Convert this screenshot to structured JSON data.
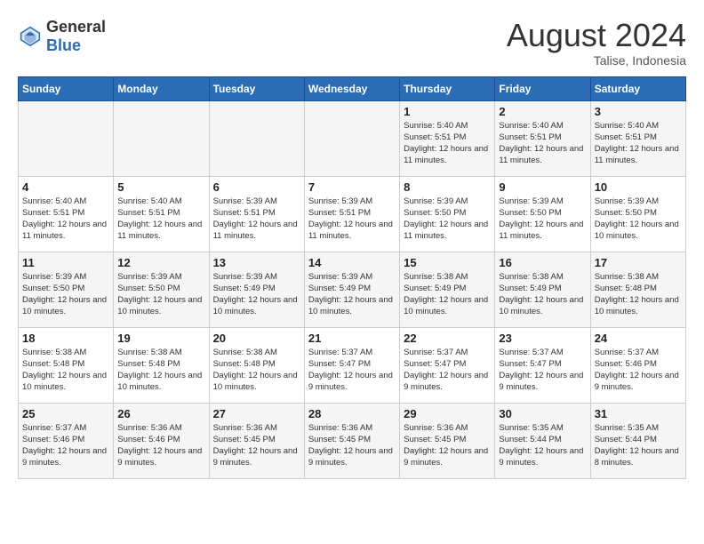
{
  "logo": {
    "text_general": "General",
    "text_blue": "Blue"
  },
  "title": "August 2024",
  "subtitle": "Talise, Indonesia",
  "weekdays": [
    "Sunday",
    "Monday",
    "Tuesday",
    "Wednesday",
    "Thursday",
    "Friday",
    "Saturday"
  ],
  "weeks": [
    [
      {
        "day": "",
        "sunrise": "",
        "sunset": "",
        "daylight": ""
      },
      {
        "day": "",
        "sunrise": "",
        "sunset": "",
        "daylight": ""
      },
      {
        "day": "",
        "sunrise": "",
        "sunset": "",
        "daylight": ""
      },
      {
        "day": "",
        "sunrise": "",
        "sunset": "",
        "daylight": ""
      },
      {
        "day": "1",
        "sunrise": "Sunrise: 5:40 AM",
        "sunset": "Sunset: 5:51 PM",
        "daylight": "Daylight: 12 hours and 11 minutes."
      },
      {
        "day": "2",
        "sunrise": "Sunrise: 5:40 AM",
        "sunset": "Sunset: 5:51 PM",
        "daylight": "Daylight: 12 hours and 11 minutes."
      },
      {
        "day": "3",
        "sunrise": "Sunrise: 5:40 AM",
        "sunset": "Sunset: 5:51 PM",
        "daylight": "Daylight: 12 hours and 11 minutes."
      }
    ],
    [
      {
        "day": "4",
        "sunrise": "Sunrise: 5:40 AM",
        "sunset": "Sunset: 5:51 PM",
        "daylight": "Daylight: 12 hours and 11 minutes."
      },
      {
        "day": "5",
        "sunrise": "Sunrise: 5:40 AM",
        "sunset": "Sunset: 5:51 PM",
        "daylight": "Daylight: 12 hours and 11 minutes."
      },
      {
        "day": "6",
        "sunrise": "Sunrise: 5:39 AM",
        "sunset": "Sunset: 5:51 PM",
        "daylight": "Daylight: 12 hours and 11 minutes."
      },
      {
        "day": "7",
        "sunrise": "Sunrise: 5:39 AM",
        "sunset": "Sunset: 5:51 PM",
        "daylight": "Daylight: 12 hours and 11 minutes."
      },
      {
        "day": "8",
        "sunrise": "Sunrise: 5:39 AM",
        "sunset": "Sunset: 5:50 PM",
        "daylight": "Daylight: 12 hours and 11 minutes."
      },
      {
        "day": "9",
        "sunrise": "Sunrise: 5:39 AM",
        "sunset": "Sunset: 5:50 PM",
        "daylight": "Daylight: 12 hours and 11 minutes."
      },
      {
        "day": "10",
        "sunrise": "Sunrise: 5:39 AM",
        "sunset": "Sunset: 5:50 PM",
        "daylight": "Daylight: 12 hours and 10 minutes."
      }
    ],
    [
      {
        "day": "11",
        "sunrise": "Sunrise: 5:39 AM",
        "sunset": "Sunset: 5:50 PM",
        "daylight": "Daylight: 12 hours and 10 minutes."
      },
      {
        "day": "12",
        "sunrise": "Sunrise: 5:39 AM",
        "sunset": "Sunset: 5:50 PM",
        "daylight": "Daylight: 12 hours and 10 minutes."
      },
      {
        "day": "13",
        "sunrise": "Sunrise: 5:39 AM",
        "sunset": "Sunset: 5:49 PM",
        "daylight": "Daylight: 12 hours and 10 minutes."
      },
      {
        "day": "14",
        "sunrise": "Sunrise: 5:39 AM",
        "sunset": "Sunset: 5:49 PM",
        "daylight": "Daylight: 12 hours and 10 minutes."
      },
      {
        "day": "15",
        "sunrise": "Sunrise: 5:38 AM",
        "sunset": "Sunset: 5:49 PM",
        "daylight": "Daylight: 12 hours and 10 minutes."
      },
      {
        "day": "16",
        "sunrise": "Sunrise: 5:38 AM",
        "sunset": "Sunset: 5:49 PM",
        "daylight": "Daylight: 12 hours and 10 minutes."
      },
      {
        "day": "17",
        "sunrise": "Sunrise: 5:38 AM",
        "sunset": "Sunset: 5:48 PM",
        "daylight": "Daylight: 12 hours and 10 minutes."
      }
    ],
    [
      {
        "day": "18",
        "sunrise": "Sunrise: 5:38 AM",
        "sunset": "Sunset: 5:48 PM",
        "daylight": "Daylight: 12 hours and 10 minutes."
      },
      {
        "day": "19",
        "sunrise": "Sunrise: 5:38 AM",
        "sunset": "Sunset: 5:48 PM",
        "daylight": "Daylight: 12 hours and 10 minutes."
      },
      {
        "day": "20",
        "sunrise": "Sunrise: 5:38 AM",
        "sunset": "Sunset: 5:48 PM",
        "daylight": "Daylight: 12 hours and 10 minutes."
      },
      {
        "day": "21",
        "sunrise": "Sunrise: 5:37 AM",
        "sunset": "Sunset: 5:47 PM",
        "daylight": "Daylight: 12 hours and 9 minutes."
      },
      {
        "day": "22",
        "sunrise": "Sunrise: 5:37 AM",
        "sunset": "Sunset: 5:47 PM",
        "daylight": "Daylight: 12 hours and 9 minutes."
      },
      {
        "day": "23",
        "sunrise": "Sunrise: 5:37 AM",
        "sunset": "Sunset: 5:47 PM",
        "daylight": "Daylight: 12 hours and 9 minutes."
      },
      {
        "day": "24",
        "sunrise": "Sunrise: 5:37 AM",
        "sunset": "Sunset: 5:46 PM",
        "daylight": "Daylight: 12 hours and 9 minutes."
      }
    ],
    [
      {
        "day": "25",
        "sunrise": "Sunrise: 5:37 AM",
        "sunset": "Sunset: 5:46 PM",
        "daylight": "Daylight: 12 hours and 9 minutes."
      },
      {
        "day": "26",
        "sunrise": "Sunrise: 5:36 AM",
        "sunset": "Sunset: 5:46 PM",
        "daylight": "Daylight: 12 hours and 9 minutes."
      },
      {
        "day": "27",
        "sunrise": "Sunrise: 5:36 AM",
        "sunset": "Sunset: 5:45 PM",
        "daylight": "Daylight: 12 hours and 9 minutes."
      },
      {
        "day": "28",
        "sunrise": "Sunrise: 5:36 AM",
        "sunset": "Sunset: 5:45 PM",
        "daylight": "Daylight: 12 hours and 9 minutes."
      },
      {
        "day": "29",
        "sunrise": "Sunrise: 5:36 AM",
        "sunset": "Sunset: 5:45 PM",
        "daylight": "Daylight: 12 hours and 9 minutes."
      },
      {
        "day": "30",
        "sunrise": "Sunrise: 5:35 AM",
        "sunset": "Sunset: 5:44 PM",
        "daylight": "Daylight: 12 hours and 9 minutes."
      },
      {
        "day": "31",
        "sunrise": "Sunrise: 5:35 AM",
        "sunset": "Sunset: 5:44 PM",
        "daylight": "Daylight: 12 hours and 8 minutes."
      }
    ]
  ]
}
